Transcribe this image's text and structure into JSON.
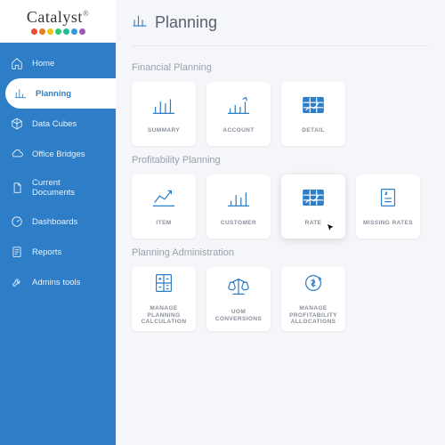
{
  "brand": {
    "name": "Catalyst"
  },
  "sidebar": {
    "items": [
      {
        "label": "Home"
      },
      {
        "label": "Planning"
      },
      {
        "label": "Data Cubes"
      },
      {
        "label": "Office Bridges"
      },
      {
        "label": "Current Documents"
      },
      {
        "label": "Dashboards"
      },
      {
        "label": "Reports"
      },
      {
        "label": "Admins tools"
      }
    ],
    "activeIndex": 1
  },
  "page": {
    "title": "Planning"
  },
  "sections": {
    "financial": {
      "title": "Financial Planning",
      "cards": [
        {
          "label": "SUMMARY"
        },
        {
          "label": "ACCOUNT"
        },
        {
          "label": "DETAIL"
        }
      ]
    },
    "profitability": {
      "title": "Profitability Planning",
      "cards": [
        {
          "label": "ITEM"
        },
        {
          "label": "CUSTOMER"
        },
        {
          "label": "RATE"
        },
        {
          "label": "MISSING RATES"
        }
      ]
    },
    "admin": {
      "title": "Planning Administration",
      "cards": [
        {
          "label": "MANAGE PLANNING CALCULATION"
        },
        {
          "label": "UOM CONVERSIONS"
        },
        {
          "label": "MANAGE PROFITABILITY ALLOCATIONS"
        }
      ]
    }
  }
}
